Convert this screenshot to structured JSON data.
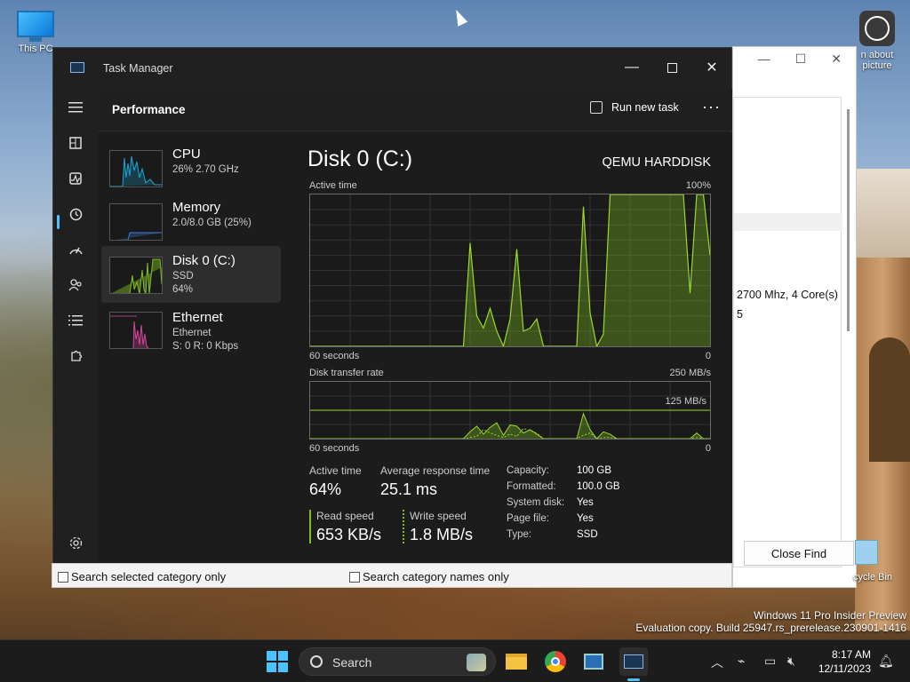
{
  "desktop": {
    "this_pc_label": "This PC",
    "about_label_1": "n about",
    "about_label_2": "picture",
    "recycle_label": "cycle Bin",
    "watermark_line1": "Windows 11 Pro Insider Preview",
    "watermark_line2": "Evaluation copy. Build 25947.rs_prerelease.230901-1416"
  },
  "background_window": {
    "processor_text": "2700 Mhz, 4 Core(s)",
    "processor_text2": "5",
    "close_find_label": "Close Find",
    "search_selected_label": "Search selected category only",
    "search_names_label": "Search category names only"
  },
  "task_manager": {
    "title": "Task Manager",
    "page_title": "Performance",
    "run_new_task_label": "Run new task",
    "more_label": "···",
    "nav_icons": [
      "menu-icon",
      "processes-icon",
      "performance-icon",
      "app-history-icon",
      "startup-apps-icon",
      "users-icon",
      "details-icon",
      "services-icon",
      "settings-icon"
    ],
    "sidebar": [
      {
        "name": "CPU",
        "sub1": "26%  2.70 GHz",
        "sub2": "",
        "color": "#17a9d8"
      },
      {
        "name": "Memory",
        "sub1": "2.0/8.0 GB (25%)",
        "sub2": "",
        "color": "#3b7fd7"
      },
      {
        "name": "Disk 0 (C:)",
        "sub1": "SSD",
        "sub2": "64%",
        "color": "#7fc021"
      },
      {
        "name": "Ethernet",
        "sub1": "Ethernet",
        "sub2": "S: 0  R: 0 Kbps",
        "color": "#d4479c"
      }
    ],
    "disk": {
      "title": "Disk 0 (C:)",
      "model": "QEMU HARDDISK",
      "graph1_label": "Active time",
      "graph1_max": "100%",
      "graph1_xleft": "60 seconds",
      "graph1_xright": "0",
      "graph2_label": "Disk transfer rate",
      "graph2_max": "250 MB/s",
      "graph2_mid": "125 MB/s",
      "graph2_xleft": "60 seconds",
      "graph2_xright": "0",
      "active_time_label": "Active time",
      "active_time_value": "64%",
      "avg_response_label": "Average response time",
      "avg_response_value": "25.1 ms",
      "read_speed_label": "Read speed",
      "read_speed_value": "653 KB/s",
      "write_speed_label": "Write speed",
      "write_speed_value": "1.8 MB/s",
      "properties": [
        {
          "k": "Capacity:",
          "v": "100 GB"
        },
        {
          "k": "Formatted:",
          "v": "100.0 GB"
        },
        {
          "k": "System disk:",
          "v": "Yes"
        },
        {
          "k": "Page file:",
          "v": "Yes"
        },
        {
          "k": "Type:",
          "v": "SSD"
        }
      ],
      "accent": "#7fc021"
    }
  },
  "chart_data": [
    {
      "type": "area",
      "title": "Active time",
      "ylim": [
        0,
        100
      ],
      "x": [
        60,
        59,
        58,
        57,
        56,
        55,
        54,
        53,
        52,
        51,
        50,
        49,
        48,
        47,
        46,
        45,
        44,
        43,
        42,
        41,
        40,
        39,
        38,
        37,
        36,
        35,
        34,
        33,
        32,
        31,
        30,
        29,
        28,
        27,
        26,
        25,
        24,
        23,
        22,
        21,
        20,
        19,
        18,
        17,
        16,
        15,
        14,
        13,
        12,
        11,
        10,
        9,
        8,
        7,
        6,
        5,
        4,
        3,
        2,
        1,
        0
      ],
      "values": [
        0,
        0,
        0,
        0,
        0,
        0,
        0,
        0,
        0,
        0,
        0,
        0,
        0,
        0,
        0,
        0,
        0,
        0,
        0,
        0,
        0,
        0,
        0,
        0,
        68,
        20,
        12,
        25,
        10,
        0,
        18,
        64,
        10,
        12,
        18,
        0,
        0,
        0,
        0,
        0,
        0,
        92,
        22,
        0,
        8,
        100,
        100,
        100,
        100,
        100,
        100,
        100,
        100,
        100,
        100,
        100,
        100,
        35,
        100,
        100,
        60
      ]
    },
    {
      "type": "line",
      "title": "Disk transfer rate",
      "ylim": [
        0,
        250
      ],
      "series": [
        {
          "values": [
            0,
            0,
            0,
            0,
            0,
            0,
            0,
            0,
            0,
            0,
            0,
            0,
            0,
            0,
            0,
            0,
            0,
            0,
            0,
            0,
            0,
            0,
            0,
            0,
            30,
            55,
            20,
            50,
            70,
            15,
            60,
            55,
            25,
            40,
            20,
            0,
            0,
            0,
            0,
            0,
            0,
            110,
            40,
            0,
            30,
            20,
            0,
            0,
            0,
            0,
            0,
            0,
            0,
            0,
            0,
            0,
            0,
            0,
            25,
            0,
            0
          ]
        },
        {
          "values": [
            0,
            0,
            0,
            0,
            0,
            0,
            0,
            0,
            0,
            0,
            0,
            0,
            0,
            0,
            0,
            0,
            0,
            0,
            0,
            0,
            0,
            0,
            0,
            0,
            5,
            10,
            40,
            25,
            15,
            5,
            20,
            10,
            45,
            35,
            25,
            0,
            0,
            0,
            0,
            0,
            0,
            15,
            25,
            0,
            5,
            5,
            0,
            0,
            0,
            0,
            0,
            0,
            0,
            0,
            0,
            0,
            0,
            0,
            5,
            0,
            0
          ]
        }
      ]
    }
  ]
}
